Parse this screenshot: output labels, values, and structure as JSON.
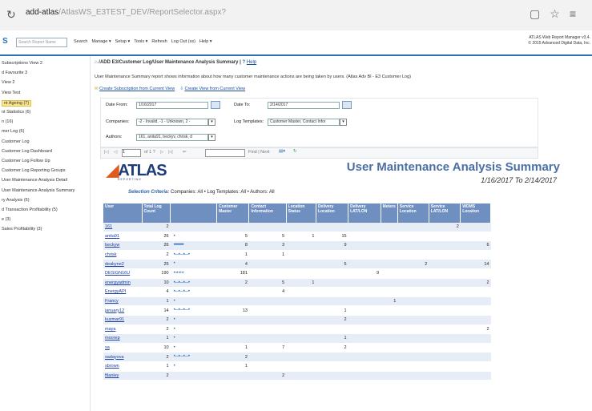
{
  "browser": {
    "url_host": "add-atlas",
    "url_path": "/AtlasWS_E3TEST_DEV/ReportSelector.aspx?"
  },
  "app": {
    "search_placeholder": "Search Report Name",
    "menu": [
      "Search",
      "Manage ▾",
      "Setup ▾",
      "Tools ▾",
      "Refresh",
      "Log Out (ss)",
      "Help ▾"
    ],
    "version_line1": "ATLAS Web Report Manager v3.4.",
    "version_line2": "© 2015 Advanced Digital Data, Inc."
  },
  "sidebar": [
    {
      "label": "Subscriptions View 2",
      "hl": false
    },
    {
      "label": "d Favourite 3",
      "hl": false
    },
    {
      "label": "View 2",
      "hl": false
    },
    {
      "label": "View Test",
      "hl": false
    },
    {
      "label": "nt Ageing (7)",
      "hl": true
    },
    {
      "label": "nt Statistics (6)",
      "hl": false
    },
    {
      "label": "n (16)",
      "hl": false
    },
    {
      "label": "mer Log (6)",
      "hl": false
    },
    {
      "label": "Customer Log",
      "hl": false
    },
    {
      "label": "Customer Log Dashboard",
      "hl": false
    },
    {
      "label": "Customer Log Follow Up",
      "hl": false
    },
    {
      "label": "Customer Log Reporting Groups",
      "hl": false
    },
    {
      "label": "User Maintenance Analysis Detail",
      "hl": false
    },
    {
      "label": "User Maintenance Analysis Summary",
      "hl": false
    },
    {
      "label": "ry Analysis (6)",
      "hl": false
    },
    {
      "label": "d Transaction Profitability (5)",
      "hl": false
    },
    {
      "label": "e (3)",
      "hl": false
    },
    {
      "label": "Sales Profitability (3)",
      "hl": false
    }
  ],
  "page": {
    "breadcrumb": "/ADD E3/Customer Log/User Maintenance Analysis Summary |",
    "help": "Help",
    "description": "User Maintenance Summary report shows information about how many customer maintenance actions are being taken by users. (Atlas Adv Bl - E3 Customer Log)",
    "link_create_sub": "Create Subscription from Current View",
    "link_create_view": "Create View from Current View"
  },
  "params": {
    "date_from_label": "Date From:",
    "date_from": "1/16/2017",
    "date_to_label": "Date To:",
    "date_to": "2/14/2017",
    "companies_label": "Companies:",
    "companies": "-2 - Invalid, -1 - Unknown, 2 -",
    "log_templates_label": "Log Templates:",
    "log_templates": "Customer Master, Contact Infor",
    "authors_label": "Authors:",
    "authors": "161, anita91, beckyv, chrisk, d"
  },
  "toolbar": {
    "page_input": "1",
    "page_of": "of 1 ?",
    "find_label": "Find | Next"
  },
  "report": {
    "logo_text": "ATLAS",
    "logo_sub": "REPORTING",
    "title": "User Maintenance Analysis Summary",
    "dates": "1/16/2017 To 2/14/2017",
    "criteria_label": "Selection Criteria:",
    "criteria_text": "Companies: All • Log Templates: All • Authors: All",
    "headers": [
      "User",
      "Total Log Count",
      "",
      "Customer Master",
      "Contact Information",
      "Location Status",
      "Delivery Location",
      "Delivery LAT/LON",
      "Meters",
      "Service Location",
      "Service LAT/LON",
      "WDMS Location"
    ],
    "rows": [
      {
        "user": "161",
        "total": "2",
        "spark": "",
        "cm": "",
        "ci": "",
        "ls": "",
        "dl": "",
        "dll": "",
        "m": "",
        "sl": "",
        "sll": "2",
        "wdms": ""
      },
      {
        "user": "anita91",
        "total": "26",
        "spark": "•",
        "cm": "5",
        "ci": "5",
        "ls": "1",
        "dl": "15",
        "dll": "",
        "m": "",
        "sl": "",
        "sll": "",
        "wdms": ""
      },
      {
        "user": "beckyw",
        "total": "26",
        "spark": "•••••••••••",
        "cm": "8",
        "ci": "3",
        "ls": "",
        "dl": "9",
        "dll": "",
        "m": "",
        "sl": "",
        "sll": "",
        "wdms": "6"
      },
      {
        "user": "chrisk",
        "total": "2",
        "spark": "•—•—•—•",
        "cm": "1",
        "ci": "1",
        "ls": "",
        "dl": "",
        "dll": "",
        "m": "",
        "sl": "",
        "sll": "",
        "wdms": ""
      },
      {
        "user": "deakyne2",
        "total": "25",
        "spark": "•",
        "cm": "4",
        "ci": "",
        "ls": "",
        "dl": "5",
        "dll": "",
        "m": "",
        "sl": "2",
        "sll": "",
        "wdms": "14"
      },
      {
        "user": "DESIGN16U",
        "total": "190",
        "spark": "•~•~•~•",
        "cm": "181",
        "ci": "",
        "ls": "",
        "dl": "",
        "dll": "9",
        "m": "",
        "sl": "",
        "sll": "",
        "wdms": ""
      },
      {
        "user": "energyadmin",
        "total": "10",
        "spark": "•—•—•—•",
        "cm": "2",
        "ci": "5",
        "ls": "1",
        "dl": "",
        "dll": "",
        "m": "",
        "sl": "",
        "sll": "",
        "wdms": "2"
      },
      {
        "user": "EnergyAPI",
        "total": "4",
        "spark": "•—•—•—•",
        "cm": "",
        "ci": "4",
        "ls": "",
        "dl": "",
        "dll": "",
        "m": "",
        "sl": "",
        "sll": "",
        "wdms": ""
      },
      {
        "user": "Francy",
        "total": "1",
        "spark": "•",
        "cm": "",
        "ci": "",
        "ls": "",
        "dl": "",
        "dll": "",
        "m": "1",
        "sl": "",
        "sll": "",
        "wdms": ""
      },
      {
        "user": "january12",
        "total": "14",
        "spark": "•—•—•—•",
        "cm": "13",
        "ci": "",
        "ls": "",
        "dl": "1",
        "dll": "",
        "m": "",
        "sl": "",
        "sll": "",
        "wdms": ""
      },
      {
        "user": "kuzmar91",
        "total": "2",
        "spark": "•",
        "cm": "",
        "ci": "",
        "ls": "",
        "dl": "2",
        "dll": "",
        "m": "",
        "sl": "",
        "sll": "",
        "wdms": ""
      },
      {
        "user": "maya",
        "total": "2",
        "spark": "•",
        "cm": "",
        "ci": "",
        "ls": "",
        "dl": "",
        "dll": "",
        "m": "",
        "sl": "",
        "sll": "",
        "wdms": "2"
      },
      {
        "user": "moorep",
        "total": "1",
        "spark": "•",
        "cm": "",
        "ci": "",
        "ls": "",
        "dl": "1",
        "dll": "",
        "m": "",
        "sl": "",
        "sll": "",
        "wdms": ""
      },
      {
        "user": "sa",
        "total": "10",
        "spark": "•",
        "cm": "1",
        "ci": "7",
        "ls": "",
        "dl": "2",
        "dll": "",
        "m": "",
        "sl": "",
        "sll": "",
        "wdms": ""
      },
      {
        "user": "sadayova",
        "total": "2",
        "spark": "•—•—•—•",
        "cm": "2",
        "ci": "",
        "ls": "",
        "dl": "",
        "dll": "",
        "m": "",
        "sl": "",
        "sll": "",
        "wdms": ""
      },
      {
        "user": "sbrown",
        "total": "1",
        "spark": "•",
        "cm": "1",
        "ci": "",
        "ls": "",
        "dl": "",
        "dll": "",
        "m": "",
        "sl": "",
        "sll": "",
        "wdms": ""
      },
      {
        "user": "ftlanley",
        "total": "2",
        "spark": "",
        "cm": "",
        "ci": "2",
        "ls": "",
        "dl": "",
        "dll": "",
        "m": "",
        "sl": "",
        "sll": "",
        "wdms": ""
      }
    ]
  }
}
